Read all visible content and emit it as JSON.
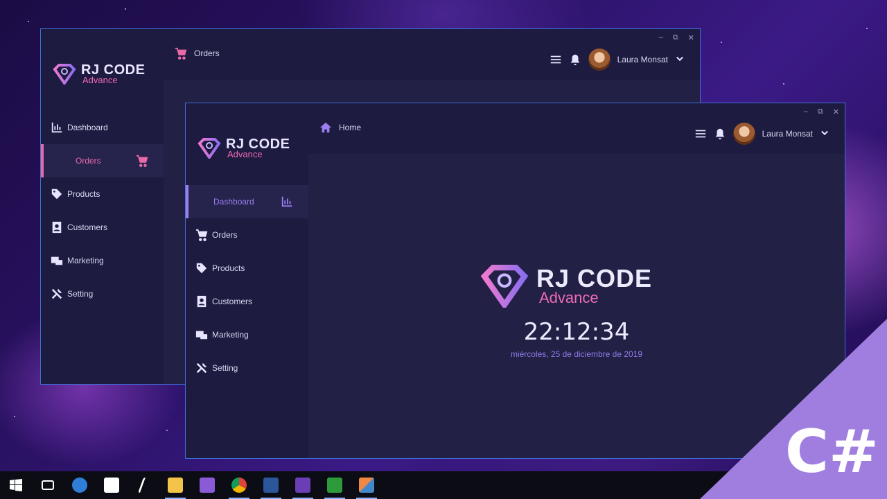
{
  "brand": {
    "name": "RJ CODE",
    "tagline": "Advance"
  },
  "window_back": {
    "breadcrumb": "Orders",
    "user": "Laura Monsat",
    "menu": [
      {
        "label": "Dashboard",
        "icon": "chart-icon"
      },
      {
        "label": "Orders",
        "icon": "cart-icon",
        "active": true
      },
      {
        "label": "Products",
        "icon": "tag-icon"
      },
      {
        "label": "Customers",
        "icon": "contacts-icon"
      },
      {
        "label": "Marketing",
        "icon": "marketing-icon"
      },
      {
        "label": "Setting",
        "icon": "tools-icon"
      }
    ],
    "accent": "#e96aa8"
  },
  "window_front": {
    "breadcrumb": "Home",
    "user": "Laura Monsat",
    "menu": [
      {
        "label": "Dashboard",
        "icon": "chart-icon",
        "active": true
      },
      {
        "label": "Orders",
        "icon": "cart-icon"
      },
      {
        "label": "Products",
        "icon": "tag-icon"
      },
      {
        "label": "Customers",
        "icon": "contacts-icon"
      },
      {
        "label": "Marketing",
        "icon": "marketing-icon"
      },
      {
        "label": "Setting",
        "icon": "tools-icon"
      }
    ],
    "accent": "#9b7ff0",
    "clock": "22:12:34",
    "date": "miércoles, 25 de diciembre de 2019"
  },
  "window_buttons": {
    "minimize": "–",
    "restore": "⧉",
    "close": "✕"
  },
  "corner_badge": "C#",
  "taskbar": {
    "apps": [
      "windows-start",
      "task-view",
      "cortana",
      "store",
      "pointer",
      "file-explorer",
      "visual-studio",
      "chrome",
      "word",
      "visual-studio-preview",
      "camtasia",
      "photo-app"
    ],
    "tray_arrow": "⌃"
  }
}
